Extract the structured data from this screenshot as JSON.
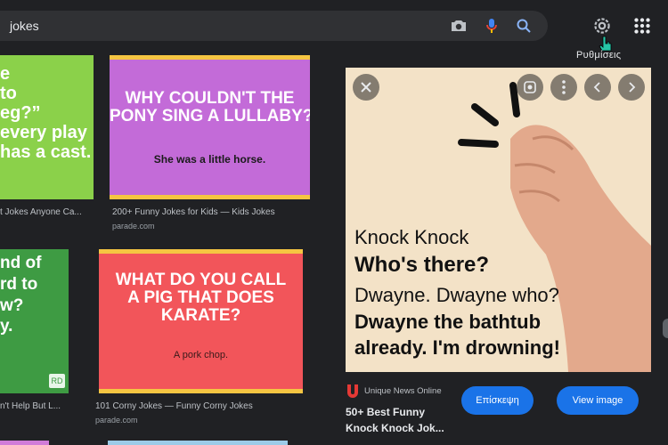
{
  "search": {
    "query": "jokes"
  },
  "tooltip": "Ρυθμίσεις",
  "colors": {
    "background": "#202124",
    "button": "#1a73e8"
  },
  "results": [
    {
      "partial_text": "e\nto\neg?”\nevery play\nhas a cast.",
      "caption": "t Jokes Anyone Ca...",
      "source": ""
    },
    {
      "headline": "WHY COULDN'T THE\nPONY SING A LULLABY?",
      "answer": "She was a little horse.",
      "caption": "200+ Funny Jokes for Kids — Kids Jokes",
      "source": "parade.com"
    },
    {
      "partial_text": "nd of\nrd to\nw?\ny.",
      "caption": "n't Help But L...",
      "source": ""
    },
    {
      "headline": "WHAT DO YOU CALL\nA PIG THAT DOES\nKARATE?",
      "answer": "A pork chop.",
      "caption": "101 Corny Jokes — Funny Corny Jokes",
      "source": "parade.com"
    }
  ],
  "preview": {
    "lines": [
      "Knock Knock",
      "Who's there?",
      "Dwayne. Dwayne who?",
      "Dwayne the bathtub",
      "already. I'm drowning!"
    ],
    "source_name": "Unique News Online",
    "title": "50+ Best Funny\nKnock Knock Jok...",
    "visit_label": "Επίσκεψη",
    "view_label": "View image"
  }
}
